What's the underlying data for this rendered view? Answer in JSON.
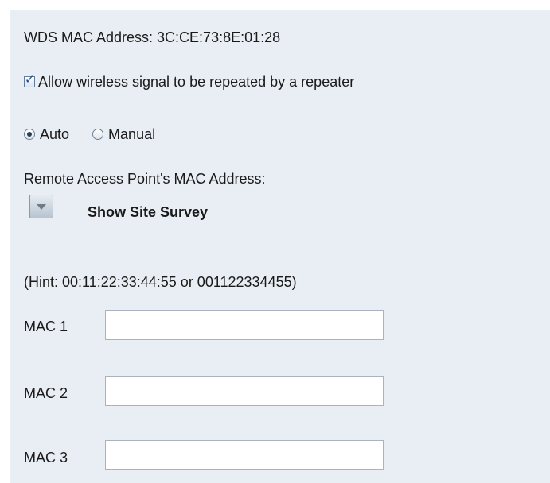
{
  "wds": {
    "mac_label": "WDS MAC Address: 3C:CE:73:8E:01:28"
  },
  "repeater": {
    "label": "Allow wireless signal to be repeated by a repeater",
    "checked": true
  },
  "mode": {
    "options": [
      "Auto",
      "Manual"
    ],
    "selected": "Auto"
  },
  "remote": {
    "label": "Remote Access Point's MAC Address:",
    "survey_label": "Show Site Survey",
    "hint": "(Hint: 00:11:22:33:44:55 or 001122334455)"
  },
  "macs": [
    {
      "label": "MAC 1",
      "value": ""
    },
    {
      "label": "MAC 2",
      "value": ""
    },
    {
      "label": "MAC 3",
      "value": ""
    }
  ],
  "icons": {
    "checkbox": "checkbox-checked-icon",
    "survey": "chevron-down-icon"
  }
}
